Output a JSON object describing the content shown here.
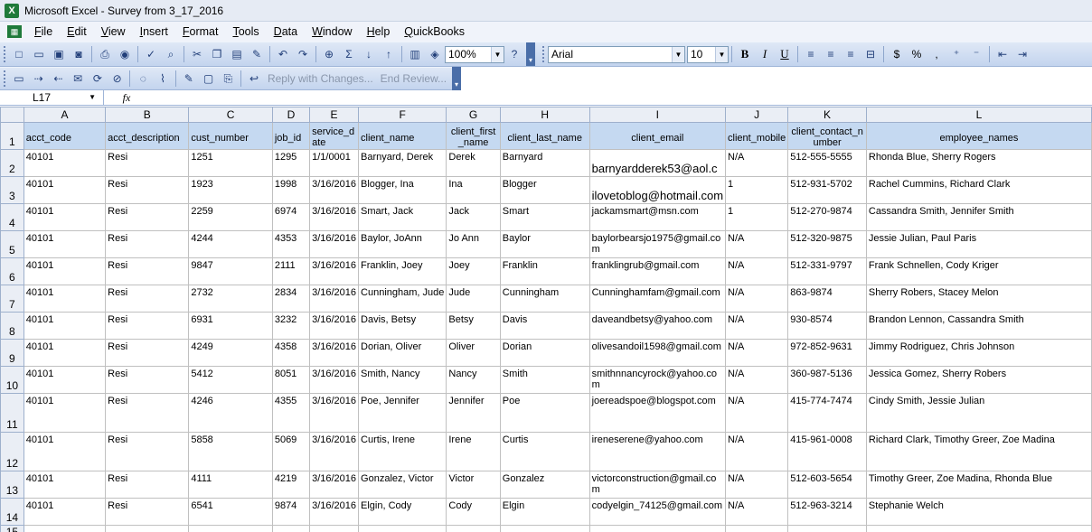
{
  "window": {
    "title": "Microsoft Excel - Survey from 3_17_2016"
  },
  "menu": [
    "File",
    "Edit",
    "View",
    "Insert",
    "Format",
    "Tools",
    "Data",
    "Window",
    "Help",
    "QuickBooks"
  ],
  "toolbar": {
    "zoom": "100%",
    "font": "Arial",
    "font_size": "10",
    "reply_label": "Reply with Changes...",
    "end_review_label": "End Review...",
    "bold": "B",
    "italic": "I",
    "underline": "U",
    "sum": "Σ",
    "currency": "$",
    "percent": "%",
    "comma": ","
  },
  "formula_bar": {
    "cell_ref": "L17",
    "fx": "fx",
    "value": ""
  },
  "columns": [
    "A",
    "B",
    "C",
    "D",
    "E",
    "F",
    "G",
    "H",
    "I",
    "J",
    "K",
    "L"
  ],
  "row_numbers": [
    "1",
    "2",
    "3",
    "4",
    "5",
    "6",
    "7",
    "8",
    "9",
    "10",
    "11",
    "12",
    "13",
    "14",
    "15"
  ],
  "headers": [
    "acct_code",
    "acct_description",
    "cust_number",
    "job_id",
    "service_date",
    "client_name",
    "client_first_name",
    "client_last_name",
    "client_email",
    "client_mobile",
    "client_contact_number",
    "employee_names"
  ],
  "rows": [
    [
      "40101",
      "Resi",
      "1251",
      "1295",
      "1/1/0001",
      "Barnyard, Derek",
      "Derek",
      "Barnyard",
      "barnyardderek53@aol.c",
      "N/A",
      "512-555-5555",
      "Rhonda Blue, Sherry Rogers"
    ],
    [
      "40101",
      "Resi",
      "1923",
      "1998",
      "3/16/2016",
      "Blogger, Ina",
      " Ina",
      "Blogger",
      "ilovetoblog@hotmail.com",
      "1",
      "512-931-5702",
      "Rachel Cummins, Richard Clark"
    ],
    [
      "40101",
      "Resi",
      "2259",
      "6974",
      "3/16/2016",
      "Smart, Jack",
      "Jack",
      "Smart",
      "jackamsmart@msn.com",
      "1",
      "512-270-9874",
      "Cassandra Smith, Jennifer Smith"
    ],
    [
      "40101",
      "Resi",
      "4244",
      "4353",
      "3/16/2016",
      "Baylor, JoAnn",
      " Jo Ann",
      "Baylor",
      "baylorbearsjo1975@gmail.com",
      "N/A",
      "512-320-9875",
      "Jessie Julian, Paul Paris"
    ],
    [
      "40101",
      "Resi",
      "9847",
      "2111",
      "3/16/2016",
      "Franklin, Joey",
      "Joey",
      "Franklin",
      "franklingrub@gmail.com",
      "N/A",
      "512-331-9797",
      "Frank Schnellen, Cody Kriger"
    ],
    [
      "40101",
      "Resi",
      "2732",
      "2834",
      "3/16/2016",
      "Cunningham, Jude",
      "Jude",
      "Cunningham",
      "Cunninghamfam@gmail.com",
      "N/A",
      "863-9874",
      "Sherry Robers, Stacey Melon"
    ],
    [
      "40101",
      "Resi",
      "6931",
      "3232",
      "3/16/2016",
      "Davis, Betsy",
      "Betsy",
      "Davis",
      "daveandbetsy@yahoo.com",
      "N/A",
      "930-8574",
      "Brandon Lennon, Cassandra Smith"
    ],
    [
      "40101",
      "Resi",
      "4249",
      "4358",
      "3/16/2016",
      "Dorian, Oliver",
      "Oliver",
      "Dorian",
      "olivesandoil1598@gmail.com",
      "N/A",
      "972-852-9631",
      "Jimmy Rodriguez, Chris Johnson"
    ],
    [
      "40101",
      "Resi",
      "5412",
      "8051",
      "3/16/2016",
      "Smith, Nancy",
      "Nancy",
      "Smith",
      "smithnnancyrock@yahoo.com",
      "N/A",
      "360-987-5136",
      "Jessica Gomez, Sherry Robers"
    ],
    [
      "40101",
      "Resi",
      "4246",
      "4355",
      "3/16/2016",
      "Poe, Jennifer",
      "Jennifer",
      "Poe",
      "joereadspoe@blogspot.com",
      "N/A",
      "415-774-7474",
      "Cindy Smith, Jessie Julian"
    ],
    [
      "40101",
      "Resi",
      "5858",
      "5069",
      "3/16/2016",
      "Curtis, Irene",
      "Irene",
      "Curtis",
      "ireneserene@yahoo.com",
      "N/A",
      "415-961-0008",
      "Richard Clark, Timothy Greer, Zoe Madina"
    ],
    [
      "40101",
      "Resi",
      "4111",
      "4219",
      "3/16/2016",
      "Gonzalez, Victor",
      "Victor",
      "Gonzalez",
      "victorconstruction@gmail.com",
      "N/A",
      "512-603-5654",
      "Timothy Greer, Zoe Madina, Rhonda Blue"
    ],
    [
      "40101",
      "Resi",
      "6541",
      "9874",
      "3/16/2016",
      "Elgin, Cody",
      "Cody",
      "Elgin",
      "codyelgin_74125@gmail.com",
      "N/A",
      "512-963-3214",
      "Stephanie Welch"
    ]
  ]
}
